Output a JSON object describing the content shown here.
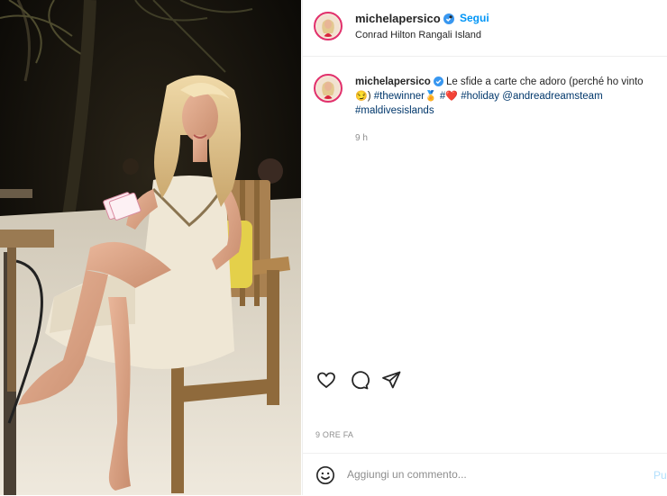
{
  "post": {
    "username": "michelapersico",
    "follow_label": "Segui",
    "separator": "•",
    "location": "Conrad Hilton Rangali Island",
    "caption": {
      "text_before": "Le sfide a carte che adoro (perché ho vinto",
      "emoji_1": "😏",
      "tag_1": "#thewinner",
      "emoji_2": "🏅",
      "tag_2": "#",
      "emoji_3": "❤️",
      "tag_3": "#holiday",
      "mention": "@andreadreamsteam",
      "tag_4": "#maldivesislands",
      "time": "9 h"
    },
    "timestamp": "9 ORE FA",
    "comment": {
      "placeholder": "Aggiungi un commento...",
      "post_label": "Pubblica"
    }
  },
  "icons": {
    "like": "heart-icon",
    "comment": "comment-icon",
    "share": "share-icon",
    "emoji": "emoji-icon",
    "verified": "verified-badge-icon"
  },
  "colors": {
    "follow": "#0095f6",
    "tag": "#00376b",
    "verified": "#3897f0",
    "avatar_ring": "#e1306c",
    "post_disabled": "#b2dffc"
  }
}
